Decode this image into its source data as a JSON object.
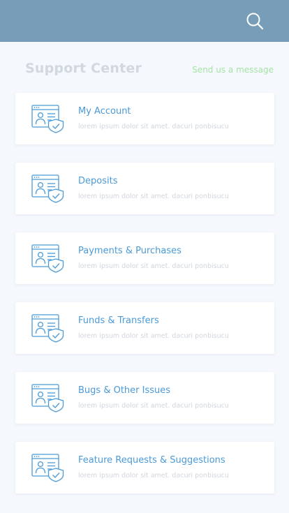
{
  "header": {
    "search_icon": "search-icon"
  },
  "page": {
    "title": "Support Center",
    "send_message": "Send us a message"
  },
  "colors": {
    "topbar": "#789db8",
    "title": "#d2d8e0",
    "link": "#a6e2a6",
    "card_title": "#4a9ad8",
    "card_desc": "#d0d6de",
    "icon_stroke": "#4a9ad8"
  },
  "categories": [
    {
      "title": "My Account",
      "desc": "lorem ipsum dolor sit amet. dacuri ponbisucu",
      "icon": "account-shield-icon"
    },
    {
      "title": "Deposits",
      "desc": "lorem ipsum dolor sit amet. dacuri ponbisucu",
      "icon": "account-shield-icon"
    },
    {
      "title": "Payments & Purchases",
      "desc": "lorem ipsum dolor sit amet. dacuri ponbisucu",
      "icon": "account-shield-icon"
    },
    {
      "title": "Funds & Transfers",
      "desc": "lorem ipsum dolor sit amet. dacuri ponbisucu",
      "icon": "account-shield-icon"
    },
    {
      "title": "Bugs & Other Issues",
      "desc": "lorem ipsum dolor sit amet. dacuri ponbisucu",
      "icon": "account-shield-icon"
    },
    {
      "title": "Feature Requests & Suggestions",
      "desc": "lorem ipsum dolor sit amet. dacuri ponbisucu",
      "icon": "account-shield-icon"
    }
  ]
}
